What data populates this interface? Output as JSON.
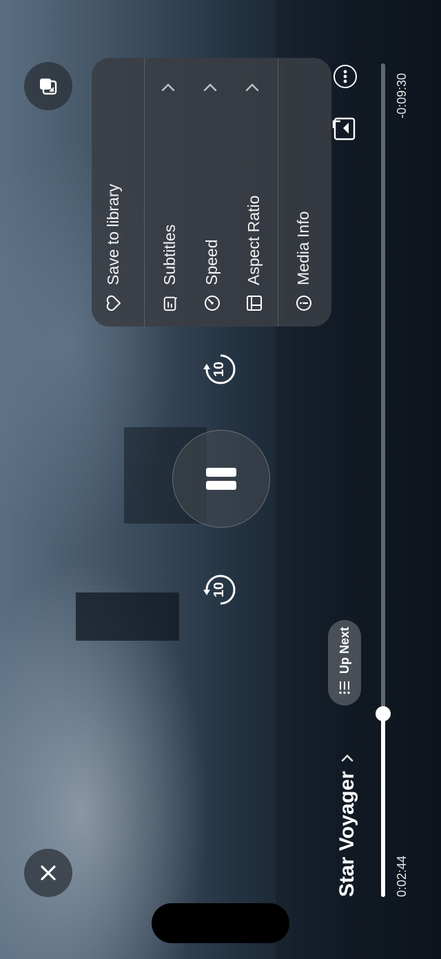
{
  "video": {
    "title": "Star Voyager",
    "elapsed": "0:02:44",
    "remaining": "-0:09:30",
    "progress": 0.22
  },
  "controls": {
    "up_next_label": "Up Next",
    "rewind_seconds": "10",
    "forward_seconds": "10"
  },
  "menu": {
    "items": [
      {
        "label": "Save to library",
        "icon": "heart-icon"
      },
      {
        "label": "Subtitles",
        "icon": "subtitles-icon"
      },
      {
        "label": "Speed",
        "icon": "speed-icon"
      },
      {
        "label": "Aspect Ratio",
        "icon": "aspect-ratio-icon"
      },
      {
        "label": "Media Info",
        "icon": "info-icon"
      }
    ]
  },
  "colors": {
    "accent": "#ffffff",
    "menu_bg": "#3a3e44"
  }
}
